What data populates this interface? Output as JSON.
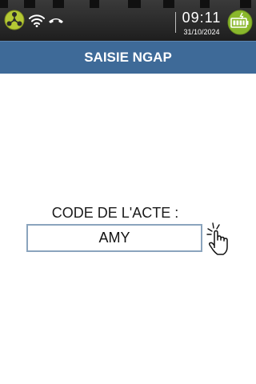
{
  "status_bar": {
    "time": "09:11",
    "date": "31/10/2024",
    "icons": [
      "network-hub-icon",
      "wifi-icon",
      "phone-hangup-icon",
      "battery-charging-icon"
    ],
    "colors": {
      "hub": "#b5c934",
      "battery": "#8ab82c"
    }
  },
  "header": {
    "title": "SAISIE NGAP",
    "background": "#3e6a98"
  },
  "form": {
    "label": "CODE DE L'ACTE :",
    "value": "AMY",
    "tap_hint_icon": "hand-tap-icon"
  }
}
